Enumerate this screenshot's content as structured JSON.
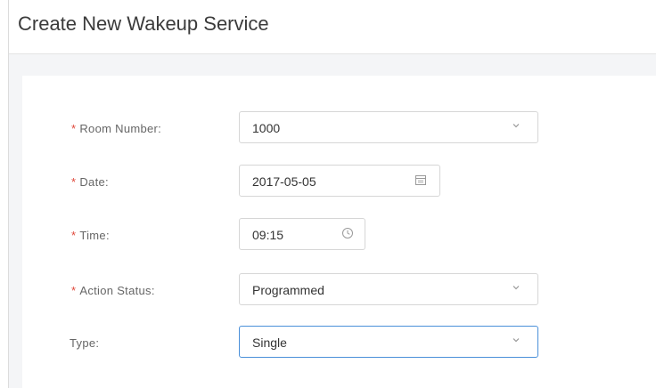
{
  "page": {
    "title": "Create New Wakeup Service"
  },
  "form": {
    "room_number": {
      "required_mark": "*",
      "label": "Room Number:",
      "value": "1000",
      "icon": "chevron-down-icon"
    },
    "date": {
      "required_mark": "*",
      "label": "Date:",
      "value": "2017-05-05",
      "icon": "calendar-icon"
    },
    "time": {
      "required_mark": "*",
      "label": "Time:",
      "value": "09:15",
      "icon": "clock-icon"
    },
    "action_status": {
      "required_mark": "*",
      "label": "Action Status:",
      "value": "Programmed",
      "icon": "chevron-down-icon"
    },
    "type": {
      "label": "Type:",
      "value": "Single",
      "icon": "chevron-down-icon"
    }
  },
  "colors": {
    "required": "#e0493c",
    "focus_border": "#4a90d9",
    "border": "#d6d6d6"
  }
}
